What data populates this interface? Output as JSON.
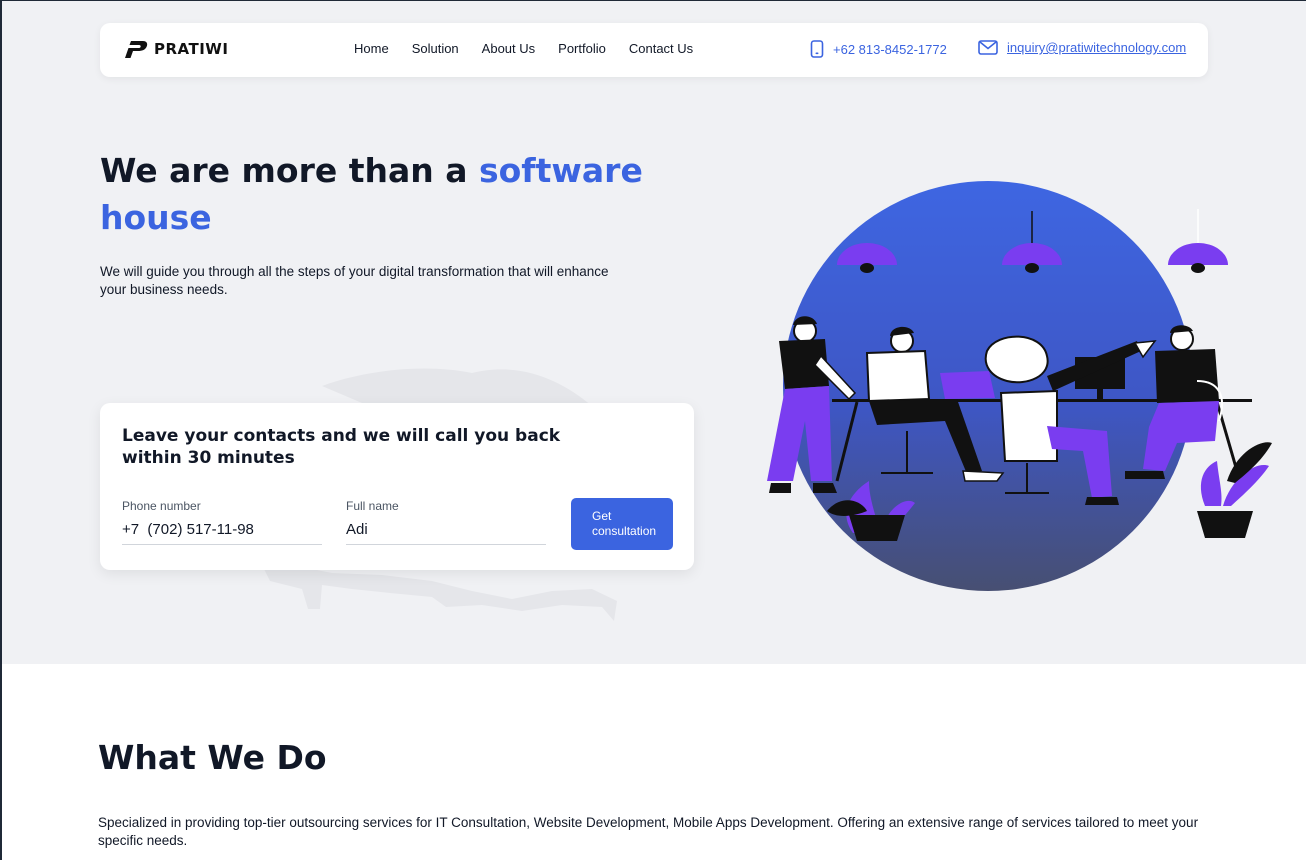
{
  "brand": {
    "name": "PRATIWI"
  },
  "nav": {
    "links": [
      "Home",
      "Solution",
      "About Us",
      "Portfolio",
      "Contact Us"
    ],
    "phone": "+62 813-8452-1772",
    "email": "inquiry@pratiwitechnology.com"
  },
  "hero": {
    "title_prefix": "We are more than a ",
    "title_accent": "software house",
    "subtitle": "We will guide you through all the steps of your digital transformation that will enhance your business needs."
  },
  "contact_form": {
    "title": "Leave your contacts and we will call you back within 30 minutes",
    "phone_label": "Phone number",
    "phone_value": "+7  (702) 517-11-98",
    "name_label": "Full name",
    "name_value": "Adi",
    "submit_label": "Get consultation"
  },
  "what_we_do": {
    "title": "What We Do",
    "description": "Specialized in providing top-tier outsourcing services for  IT Consultation, Website Development, Mobile Apps Development. Offering an extensive range of services tailored to meet your specific needs."
  },
  "colors": {
    "accent": "#3b64e0",
    "hero_bg": "#f0f1f4",
    "illustration_purple": "#7a3df0",
    "text_dark": "#111827"
  },
  "icons": [
    "pratiwi-logo-icon",
    "phone-icon",
    "mail-icon"
  ]
}
